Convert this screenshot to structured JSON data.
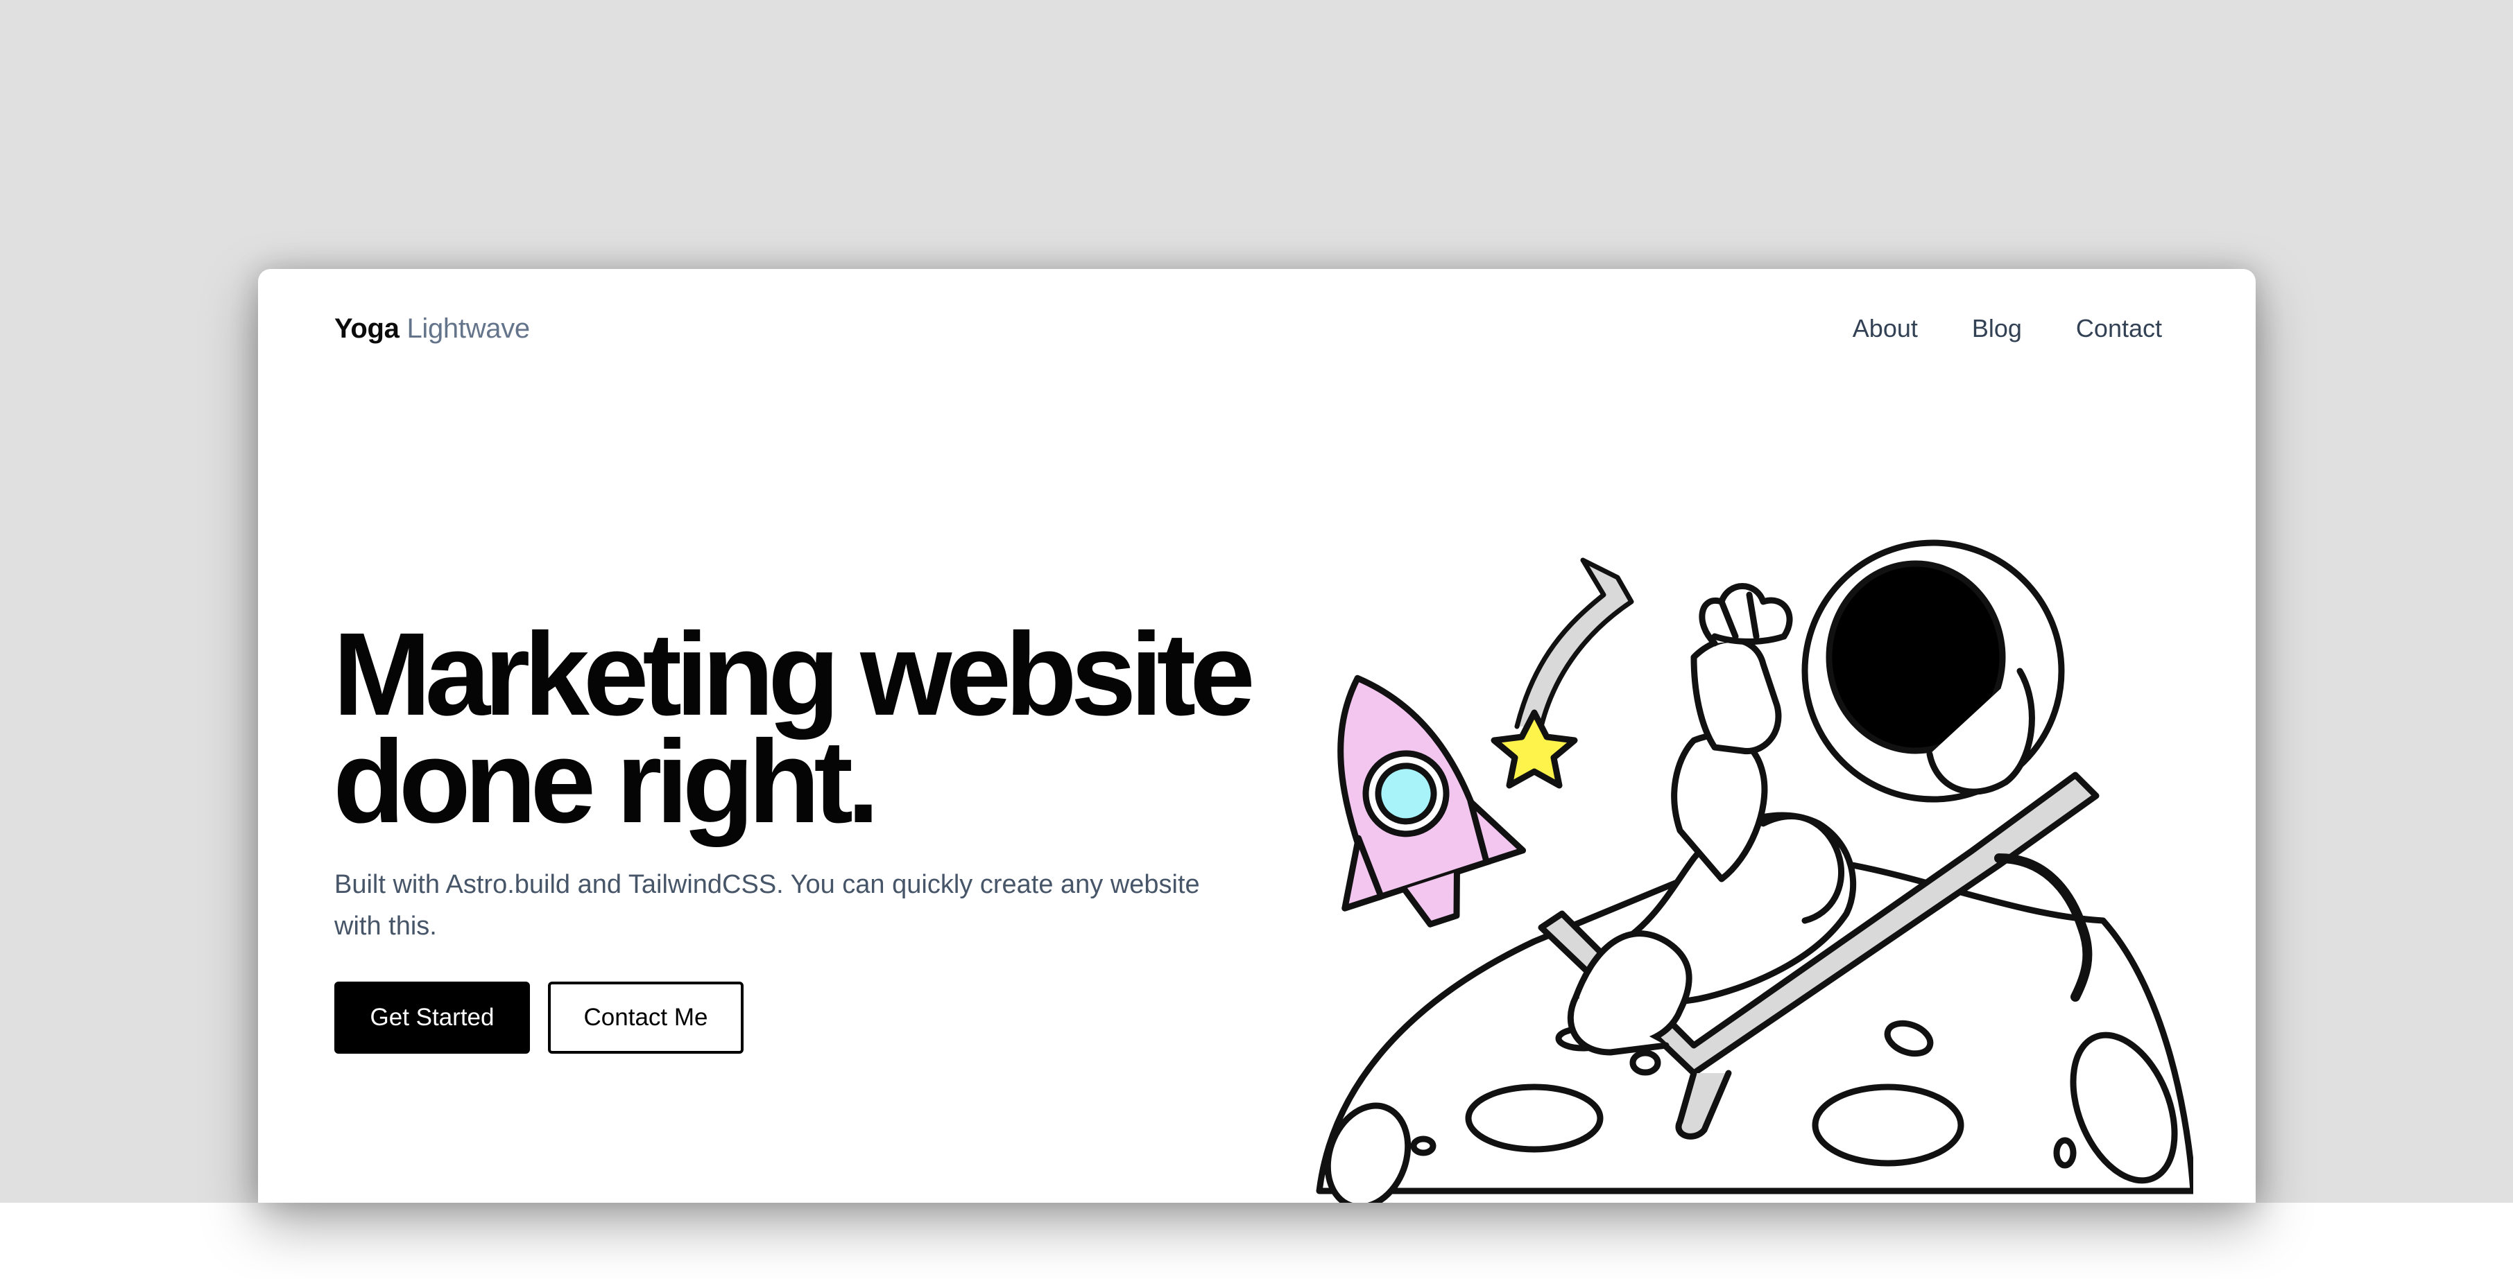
{
  "brand": {
    "name_strong": "Yoga",
    "name_light": "Lightwave"
  },
  "nav": {
    "links": [
      "About",
      "Blog",
      "Contact"
    ]
  },
  "hero": {
    "title_line1": "Marketing website",
    "title_line2": "done right.",
    "subtitle": "Built with Astro.build and TailwindCSS. You can quickly create any website with this.",
    "primary_button": "Get Started",
    "secondary_button": "Contact Me"
  },
  "illustration": {
    "name": "astronaut-on-moon-illustration"
  },
  "colors": {
    "page_background": "#e0e0e0",
    "card_background": "#ffffff",
    "text_primary": "#050505",
    "text_muted": "#475569",
    "logo_light": "#64748b",
    "rocket_pink": "#f3c6ef",
    "rocket_window": "#a7f3f9",
    "star_yellow": "#fef34a",
    "chair_grey": "#d9d9d9"
  }
}
